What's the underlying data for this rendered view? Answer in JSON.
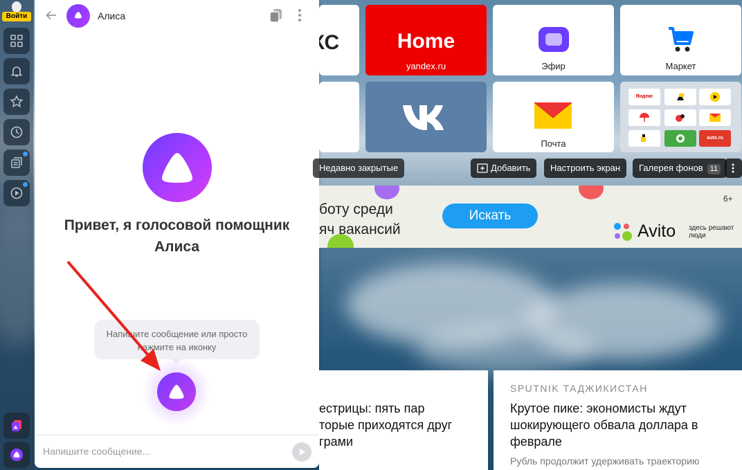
{
  "sidebar": {
    "login_label": "Войти",
    "items": [
      {
        "icon": "grid-icon"
      },
      {
        "icon": "bell-icon"
      },
      {
        "icon": "star-icon"
      },
      {
        "icon": "clock-icon"
      },
      {
        "icon": "feed-icon"
      },
      {
        "icon": "play-icon"
      }
    ],
    "accent": "#3d9aff"
  },
  "alice": {
    "title": "Алиса",
    "greeting": "Привет, я голосовой помощник Алиса",
    "hint": "Напишите сообщение или просто нажмите на иконку",
    "input_placeholder": "Напишите сообщение...",
    "brand_color": "#7a3cff"
  },
  "tiles": [
    {
      "label": "ЯКС"
    },
    {
      "big": "Home",
      "label": "yandex.ru",
      "color": "#ee0000"
    },
    {
      "label": "Эфир"
    },
    {
      "label": "Маркет"
    },
    {
      "label": ""
    },
    {
      "label": "",
      "icon": "vk-icon"
    },
    {
      "label": "Почта"
    },
    {
      "minis": [
        "Яндекс",
        "",
        "",
        "",
        "",
        "",
        "",
        "",
        "auto.ru"
      ]
    }
  ],
  "toolbar": {
    "recent": "Недавно закрытые",
    "add": "Добавить",
    "customize": "Настроить экран",
    "gallery": "Галерея фонов",
    "gallery_count": "11"
  },
  "ad": {
    "line1": "боту среди",
    "line2": "яч вакансий",
    "button": "Искать",
    "age": "6+",
    "brand": "Avito",
    "slogan": "здесь решают люди"
  },
  "news": [
    {
      "source": "",
      "title": "естрицы: пять пар\nторые приходятся друг\nграми",
      "sub": ""
    },
    {
      "source": "SPUTNIK ТАДЖИКИСТАН",
      "title": "Крутое пике: экономисты ждут\nшокирующего обвала доллара в\nфеврале",
      "sub": "Рубль продолжит удерживать траекторию"
    }
  ]
}
